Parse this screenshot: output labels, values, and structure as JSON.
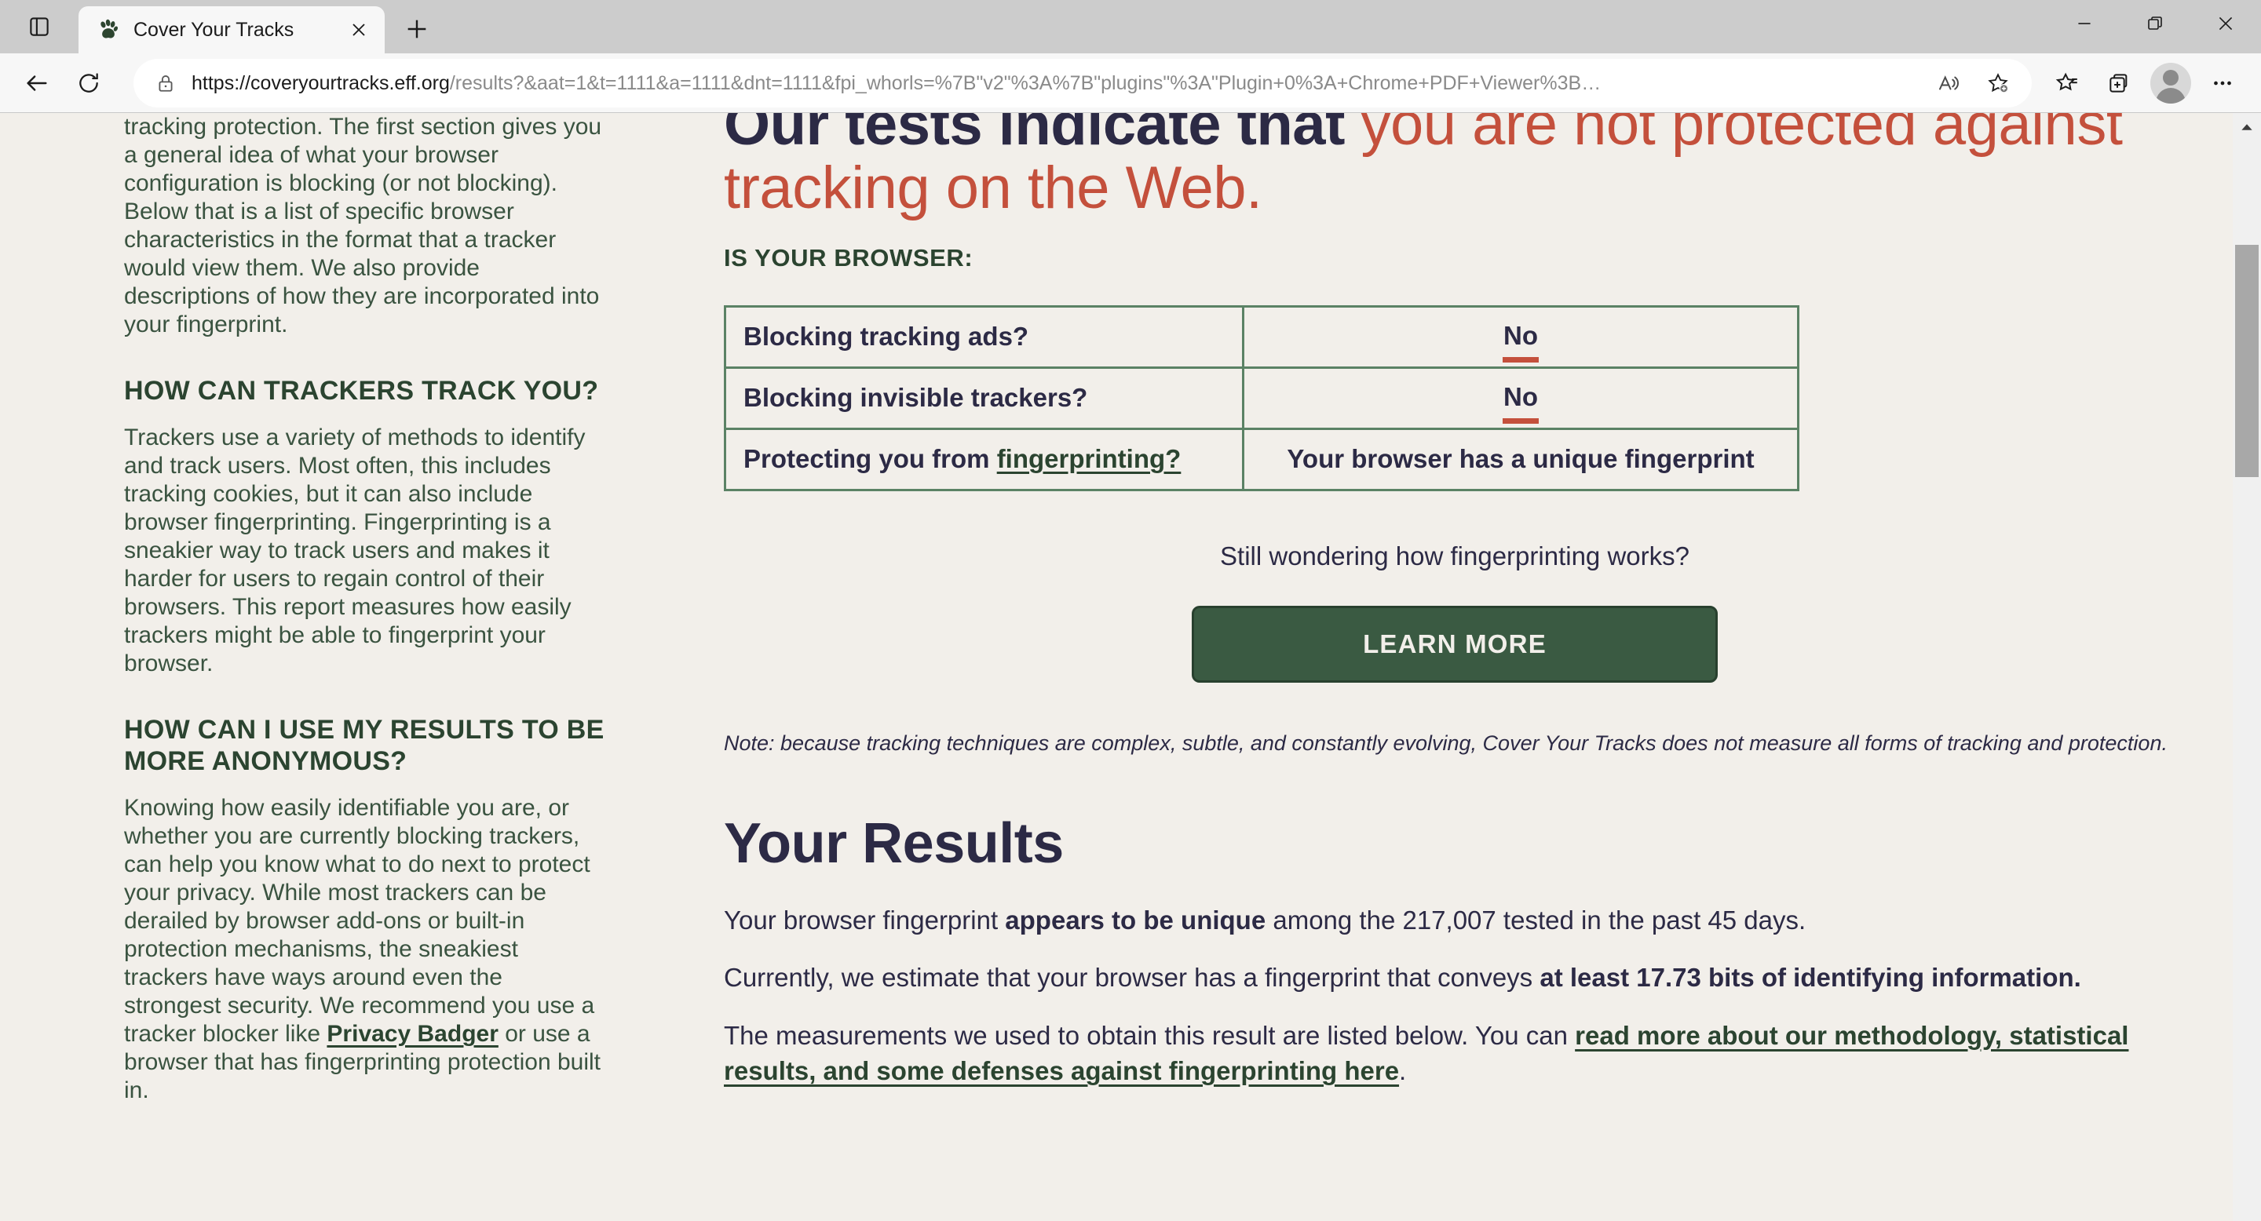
{
  "browser": {
    "sidebar_toggle_icon": "split-screen-icon",
    "tab": {
      "title": "Cover Your Tracks",
      "favicon": "paw-print-icon",
      "close_icon": "close-icon"
    },
    "new_tab_label": "+",
    "window_controls": {
      "minimize": "minimize-icon",
      "restore": "restore-icon",
      "close": "close-icon"
    },
    "toolbar": {
      "back_icon": "back-arrow-icon",
      "refresh_icon": "refresh-icon",
      "lock_icon": "lock-icon",
      "url_scheme_host": "https://coveryourtracks.eff.org",
      "url_path_query": "/results?&aat=1&t=1111&a=1111&dnt=1111&fpi_whorls=%7B\"v2\"%3A%7B\"plugins\"%3A\"Plugin+0%3A+Chrome+PDF+Viewer%3B…",
      "read_aloud_icon": "read-aloud-icon",
      "add_favorite_icon": "add-favorite-star-icon",
      "favorites_icon": "favorites-list-icon",
      "collections_icon": "collections-icon",
      "profile_icon": "profile-avatar-icon",
      "settings_icon": "more-options-icon"
    }
  },
  "sidebar": {
    "intro_paragraph": "tracking protection. The first section gives you a general idea of what your browser configuration is blocking (or not blocking). Below that is a list of specific browser characteristics in the format that a tracker would view them. We also provide descriptions of how they are incorporated into your fingerprint.",
    "sections": [
      {
        "heading": "HOW CAN TRACKERS TRACK YOU?",
        "body": "Trackers use a variety of methods to identify and track users. Most often, this includes tracking cookies, but it can also include browser fingerprinting. Fingerprinting is a sneakier way to track users and makes it harder for users to regain control of their browsers. This report measures how easily trackers might be able to fingerprint your browser."
      },
      {
        "heading": "HOW CAN I USE MY RESULTS TO BE MORE ANONYMOUS?",
        "body_before_link": "Knowing how easily identifiable you are, or whether you are currently blocking trackers, can help you know what to do next to protect your privacy. While most trackers can be derailed by browser add-ons or built-in protection mechanisms, the sneakiest trackers have ways around even the strongest security. We recommend you use a tracker blocker like ",
        "link_text": "Privacy Badger",
        "body_after_link": " or use a browser that has fingerprinting protection built in."
      }
    ]
  },
  "main": {
    "headline_dark": "Our tests indicate that ",
    "headline_red": "you are not protected against tracking on the Web.",
    "subhead": "IS YOUR BROWSER:",
    "table": {
      "rows": [
        {
          "question": "Blocking tracking ads?",
          "answer": "No",
          "answer_style": "negative"
        },
        {
          "question": "Blocking invisible trackers?",
          "answer": "No",
          "answer_style": "negative"
        },
        {
          "question_before_link": "Protecting you from ",
          "question_link": "fingerprinting?",
          "answer": "Your browser has a unique fingerprint",
          "answer_style": "plain"
        }
      ]
    },
    "wondering_text": "Still wondering how fingerprinting works?",
    "learn_more_label": "LEARN MORE",
    "note": "Note: because tracking techniques are complex, subtle, and constantly evolving, Cover Your Tracks does not measure all forms of tracking and protection.",
    "results_title": "Your Results",
    "result_p1": {
      "before": "Your browser fingerprint ",
      "bold": "appears to be unique",
      "after": " among the 217,007 tested in the past 45 days."
    },
    "result_p2": {
      "before": "Currently, we estimate that your browser has a fingerprint that conveys ",
      "bold": "at least 17.73 bits of identifying information."
    },
    "result_p3": {
      "before": "The measurements we used to obtain this result are listed below. You can ",
      "link": "read more about our methodology, statistical results, and some defenses against fingerprinting here",
      "after": "."
    },
    "stats": {
      "total_tested": "217,007",
      "period_days": "45",
      "bits_of_entropy": "17.73"
    }
  },
  "scrollbar": {
    "up_arrow_icon": "scroll-up-arrow-icon"
  },
  "colors": {
    "page_background": "#f2efea",
    "heading_dark": "#2c2a45",
    "accent_red": "#c4503c",
    "accent_green": "#3a5a42",
    "table_border": "#5b8265",
    "sidebar_text": "#3a5340"
  }
}
